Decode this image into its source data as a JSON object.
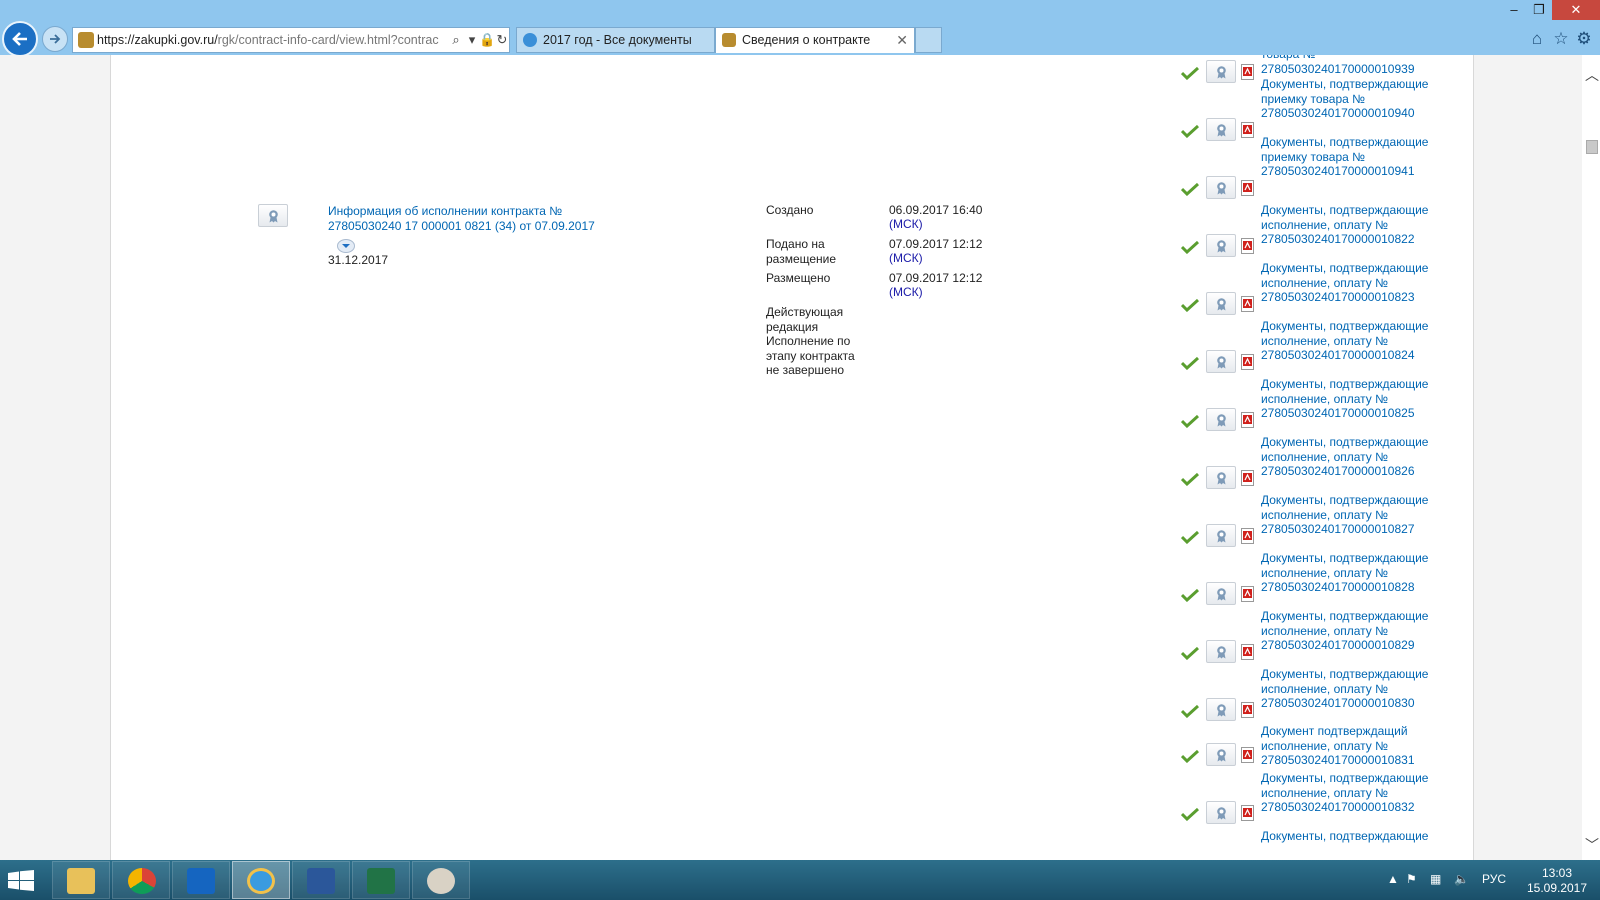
{
  "browser": {
    "url_main": "https://zakupki.gov.ru/",
    "url_path": "rgk/contract-info-card/view.html?contrac",
    "tabs": [
      {
        "label": "2017 год - Все документы",
        "active": false
      },
      {
        "label": "Сведения о контракте",
        "active": true
      }
    ],
    "window_buttons": {
      "minimize": "–",
      "restore": "❐",
      "close": "✕"
    }
  },
  "main_record": {
    "title": "Информация об исполнении контракта № 27805030240 17 000001 0821 (34) от 07.09.2017",
    "date": "31.12.2017",
    "rows": [
      {
        "label": "Создано",
        "value": "06.09.2017 16:40",
        "zone": "(МСК)"
      },
      {
        "label": "Подано на размещение",
        "value": "07.09.2017 12:12",
        "zone": "(МСК)"
      },
      {
        "label": "Размещено",
        "value": "07.09.2017 12:12",
        "zone": "(МСК)"
      }
    ],
    "status_label": "Действующая редакция",
    "status_value": "Исполнение по этапу контракта не завершено"
  },
  "documents": [
    {
      "text": "товара № 2780503024017000001093​9",
      "clean": "товара № 27805030240170000010939"
    },
    {
      "text": "Документы, подтверждающие приемку товара № 27805030240170000010940"
    },
    {
      "text": "Документы, подтверждающие приемку товара № 27805030240170000010941"
    },
    {
      "text": "Документы, подтверждающие исполнение, оплату № 27805030240170000010822"
    },
    {
      "text": "Документы, подтверждающие исполнение, оплату № 27805030240170000010823"
    },
    {
      "text": "Документы, подтверждающие исполнение, оплату № 27805030240170000010824"
    },
    {
      "text": "Документы, подтверждающие исполнение, оплату № 27805030240170000010825"
    },
    {
      "text": "Документы, подтверждающие исполнение, оплату № 27805030240170000010826"
    },
    {
      "text": "Документы, подтверждающие исполнение, оплату № 27805030240170000010827"
    },
    {
      "text": "Документы, подтверждающие исполнение, оплату № 27805030240170000010828"
    },
    {
      "text": "Документы, подтверждающие исполнение, оплату № 27805030240170000010829"
    },
    {
      "text": "Документы, подтверждающие исполнение, оплату № 27805030240170000010830"
    },
    {
      "text": "Документ подтверждащий исполнение, оплату № 27805030240170000010831"
    },
    {
      "text": "Документы, подтверждающие исполнение, оплату № 27805030240170000010832"
    },
    {
      "text": "Документы, подтверждающие"
    }
  ],
  "taskbar": {
    "apps": [
      "file-explorer",
      "chrome",
      "outlook",
      "internet-explorer",
      "word",
      "excel",
      "paint"
    ],
    "active_app": "internet-explorer",
    "language": "РУС",
    "time": "13:03",
    "date": "15.09.2017"
  },
  "colors": {
    "link": "#0066b3",
    "msk": "#1a1aa8",
    "chrome_bg": "#8fc6ee",
    "check": "#5a9e2f",
    "pdf": "#d0211c"
  }
}
